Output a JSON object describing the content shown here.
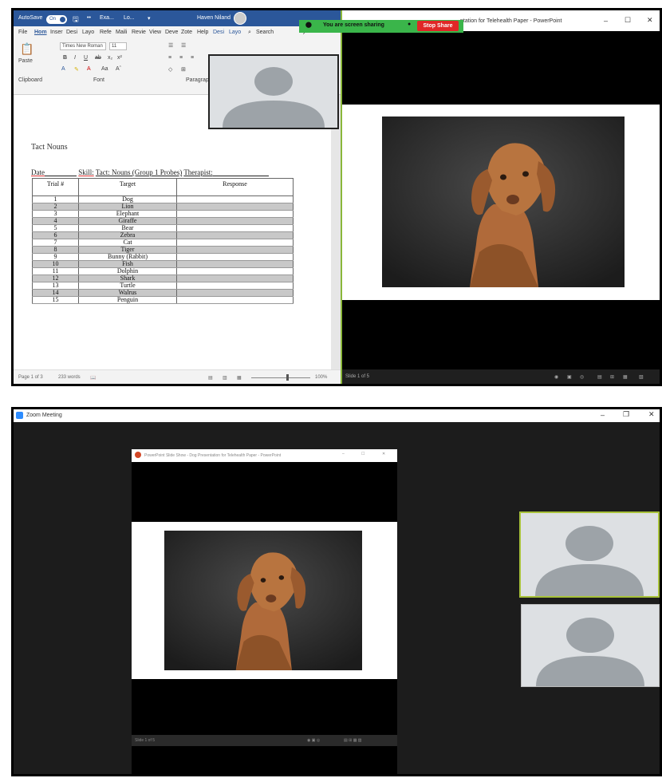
{
  "word": {
    "autosave": "AutoSave",
    "autosave_state": "On",
    "doc_name": "Exa...",
    "doc_name2": "Lo...",
    "user": "Haven Niland",
    "tabs": [
      "File",
      "Hom",
      "Inser",
      "Desi",
      "Layo",
      "Refe",
      "Maili",
      "Revie",
      "View",
      "Deve",
      "Zote",
      "Help",
      "Desi",
      "Layo"
    ],
    "search": "Search",
    "font_name": "Times New Roman",
    "font_size": "11",
    "paste": "Paste",
    "clipboard": "Clipboard",
    "font_group": "Font",
    "paragraph_group": "Paragrap",
    "doc_title": "Tact Nouns",
    "header_date": "Date",
    "header_skill": "Skill:",
    "header_skill_value": "Tact: Nouns (Group 1 Probes)",
    "header_therapist": "Therapist:",
    "table_headers": [
      "Trial #",
      "Target",
      "Response"
    ],
    "rows": [
      {
        "n": "1",
        "t": "Dog"
      },
      {
        "n": "2",
        "t": "Lion"
      },
      {
        "n": "3",
        "t": "Elephant"
      },
      {
        "n": "4",
        "t": "Giraffe"
      },
      {
        "n": "5",
        "t": "Bear"
      },
      {
        "n": "6",
        "t": "Zebra"
      },
      {
        "n": "7",
        "t": "Cat"
      },
      {
        "n": "8",
        "t": "Tiger"
      },
      {
        "n": "9",
        "t": "Bunny (Rabbit)"
      },
      {
        "n": "10",
        "t": "Fish"
      },
      {
        "n": "11",
        "t": "Dolphin"
      },
      {
        "n": "12",
        "t": "Shark"
      },
      {
        "n": "13",
        "t": "Turtle"
      },
      {
        "n": "14",
        "t": "Walrus"
      },
      {
        "n": "15",
        "t": "Penguin"
      }
    ],
    "status_page": "Page 1 of 3",
    "status_words": "233 words",
    "zoom": "100%"
  },
  "share": {
    "sharing": "You are screen sharing",
    "stop": "Stop Share"
  },
  "ppt": {
    "title": "ntation for Telehealth Paper - PowerPoint",
    "status": "Slide 1 of 5"
  },
  "zoom": {
    "title": "Zoom Meeting",
    "slideshow_title": "PowerPoint Slide Show - Dog Presentation for Telehealth Paper - PowerPoint",
    "slideshow_status": "Slide 1 of 5"
  },
  "colors": {
    "word_blue": "#2b579a",
    "share_green": "#3ab54a",
    "stop_red": "#e02727",
    "active_border": "#8ab73a"
  }
}
